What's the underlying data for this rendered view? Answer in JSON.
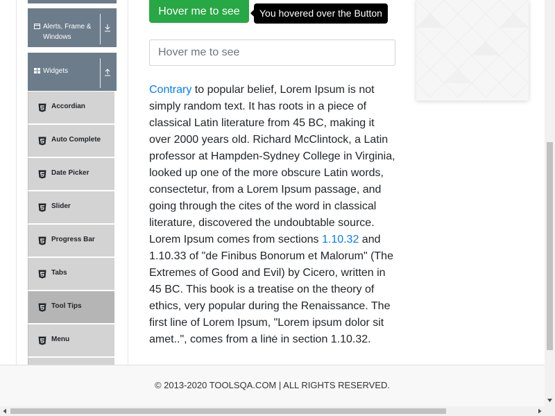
{
  "sidebar": {
    "groups": [
      {
        "label": "Alerts, Frame & Windows",
        "icon": "window-icon",
        "toggle": "download-arrow-icon"
      },
      {
        "label": "Widgets",
        "icon": "grid-icon",
        "toggle": "upload-arrow-icon"
      }
    ],
    "items": [
      {
        "label": "Accordian"
      },
      {
        "label": "Auto Complete"
      },
      {
        "label": "Date Picker"
      },
      {
        "label": "Slider"
      },
      {
        "label": "Progress Bar"
      },
      {
        "label": "Tabs"
      },
      {
        "label": "Tool Tips"
      },
      {
        "label": "Menu"
      }
    ],
    "active_item": "Tool Tips",
    "item_icon": "html5-icon"
  },
  "main": {
    "hover_button_label": "Hover me to see",
    "tooltip_text": "You hovered over the Button",
    "hover_field_placeholder": "Hover me to see",
    "paragraph": {
      "link1": "Contrary",
      "text1": " to popular belief, Lorem Ipsum is not simply random text. It has roots in a piece of classical Latin literature from 45 BC, making it over 2000 years old. Richard McClintock, a Latin professor at Hampden-Sydney College in Virginia, looked up one of the more obscure Latin words, consectetur, from a Lorem Ipsum passage, and going through the cites of the word in classical literature, discovered the undoubtable source. Lorem Ipsum comes from sections ",
      "link2": "1.10.32",
      "text2": " and 1.10.33 of \"de Finibus Bonorum et Malorum\" (The Extremes of Good and Evil) by Cicero, written in 45 BC. This book is a treatise on the theory of ethics, very popular during the Renaissance. The first line of Lorem Ipsum, \"Lorem ipsum dolor sit amet..\", comes from a line in section 1.10.32."
    }
  },
  "footer": {
    "copyright": "© 2013-2020 TOOLSQA.COM | ALL RIGHTS RESERVED."
  },
  "colors": {
    "sidebar_group": "#6c7c8b",
    "sidebar_item": "#d3d3d3",
    "sidebar_item_active": "#b5b5b5",
    "button_green": "#28a745",
    "link_blue": "#007bff",
    "tooltip_bg": "#000000"
  }
}
